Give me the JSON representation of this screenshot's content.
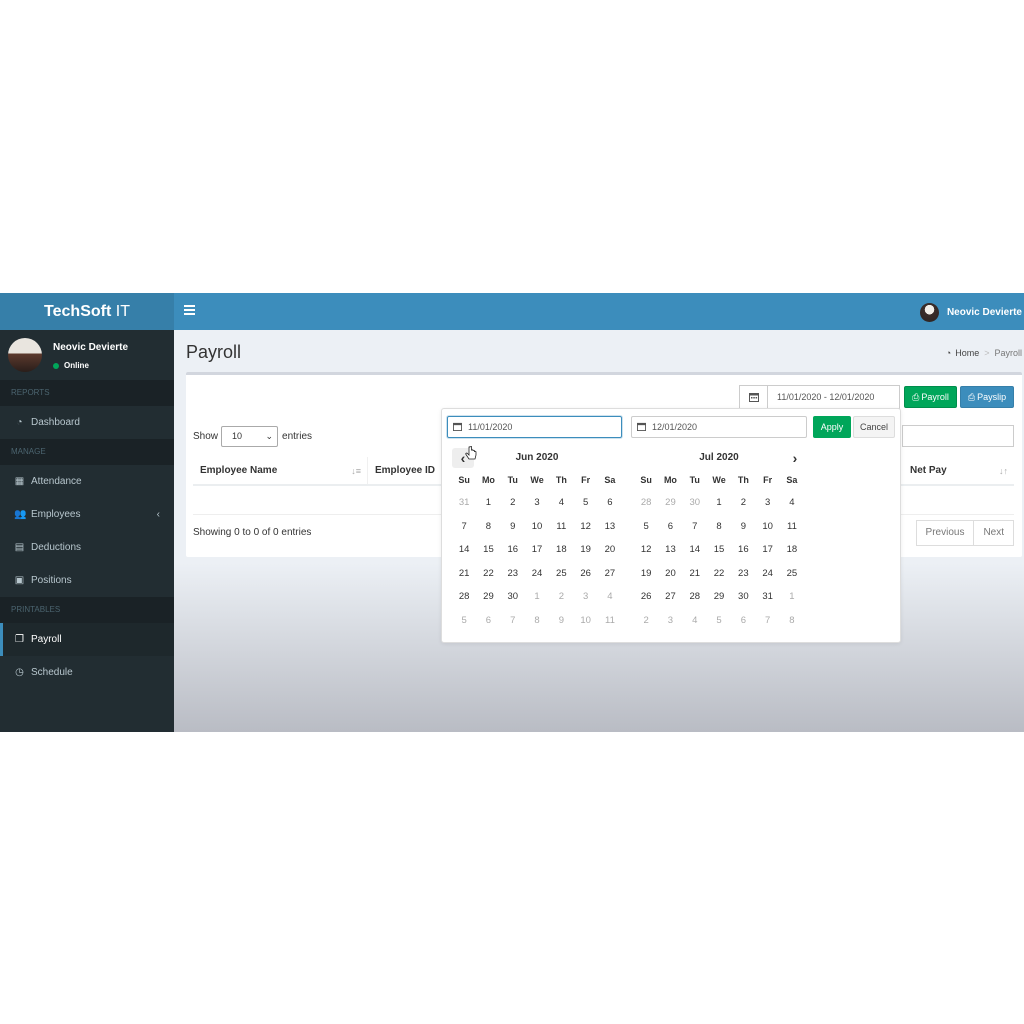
{
  "brand": {
    "bold": "TechSoft",
    "rest": " IT"
  },
  "navbar": {
    "user_name": "Neovic Devierte"
  },
  "sidebar": {
    "user": {
      "name": "Neovic Devierte",
      "status": "Online"
    },
    "sections": [
      {
        "header": "REPORTS",
        "items": [
          {
            "label": "Dashboard",
            "icon": "dashboard-icon",
            "glyph": "◔"
          }
        ]
      },
      {
        "header": "MANAGE",
        "items": [
          {
            "label": "Attendance",
            "icon": "calendar-icon",
            "glyph": "▦"
          },
          {
            "label": "Employees",
            "icon": "users-icon",
            "glyph": "👥",
            "chevron": "‹"
          },
          {
            "label": "Deductions",
            "icon": "file-icon",
            "glyph": "▤"
          },
          {
            "label": "Positions",
            "icon": "briefcase-icon",
            "glyph": "▣"
          }
        ]
      },
      {
        "header": "PRINTABLES",
        "items": [
          {
            "label": "Payroll",
            "icon": "files-icon",
            "glyph": "❐",
            "active": true
          },
          {
            "label": "Schedule",
            "icon": "clock-icon",
            "glyph": "◷"
          }
        ]
      }
    ]
  },
  "page": {
    "title": "Payroll",
    "breadcrumb": {
      "home": "Home",
      "current": "Payroll"
    }
  },
  "toolbar": {
    "date_range": "11/01/2020 - 12/01/2020",
    "payroll_button": "Payroll",
    "payslip_button": "Payslip"
  },
  "table": {
    "show_label": "Show",
    "entries_label": "entries",
    "page_length": "10",
    "columns": [
      "Employee Name",
      "Employee ID",
      "Net Pay"
    ],
    "info": "Showing 0 to 0 of 0 entries",
    "previous": "Previous",
    "next": "Next"
  },
  "datepicker": {
    "start": "11/01/2020",
    "end": "12/01/2020",
    "apply": "Apply",
    "cancel": "Cancel",
    "weekdays": [
      "Su",
      "Mo",
      "Tu",
      "We",
      "Th",
      "Fr",
      "Sa"
    ],
    "months": [
      {
        "label": "Jun 2020",
        "days": [
          [
            "31",
            1
          ],
          [
            "1",
            0
          ],
          [
            "2",
            0
          ],
          [
            "3",
            0
          ],
          [
            "4",
            0
          ],
          [
            "5",
            0
          ],
          [
            "6",
            0
          ],
          [
            "7",
            0
          ],
          [
            "8",
            0
          ],
          [
            "9",
            0
          ],
          [
            "10",
            0
          ],
          [
            "11",
            0
          ],
          [
            "12",
            0
          ],
          [
            "13",
            0
          ],
          [
            "14",
            0
          ],
          [
            "15",
            0
          ],
          [
            "16",
            0
          ],
          [
            "17",
            0
          ],
          [
            "18",
            0
          ],
          [
            "19",
            0
          ],
          [
            "20",
            0
          ],
          [
            "21",
            0
          ],
          [
            "22",
            0
          ],
          [
            "23",
            0
          ],
          [
            "24",
            0
          ],
          [
            "25",
            0
          ],
          [
            "26",
            0
          ],
          [
            "27",
            0
          ],
          [
            "28",
            0
          ],
          [
            "29",
            0
          ],
          [
            "30",
            0
          ],
          [
            "1",
            1
          ],
          [
            "2",
            1
          ],
          [
            "3",
            1
          ],
          [
            "4",
            1
          ],
          [
            "5",
            1
          ],
          [
            "6",
            1
          ],
          [
            "7",
            1
          ],
          [
            "8",
            1
          ],
          [
            "9",
            1
          ],
          [
            "10",
            1
          ],
          [
            "11",
            1
          ]
        ]
      },
      {
        "label": "Jul 2020",
        "days": [
          [
            "28",
            1
          ],
          [
            "29",
            1
          ],
          [
            "30",
            1
          ],
          [
            "1",
            0
          ],
          [
            "2",
            0
          ],
          [
            "3",
            0
          ],
          [
            "4",
            0
          ],
          [
            "5",
            0
          ],
          [
            "6",
            0
          ],
          [
            "7",
            0
          ],
          [
            "8",
            0
          ],
          [
            "9",
            0
          ],
          [
            "10",
            0
          ],
          [
            "11",
            0
          ],
          [
            "12",
            0
          ],
          [
            "13",
            0
          ],
          [
            "14",
            0
          ],
          [
            "15",
            0
          ],
          [
            "16",
            0
          ],
          [
            "17",
            0
          ],
          [
            "18",
            0
          ],
          [
            "19",
            0
          ],
          [
            "20",
            0
          ],
          [
            "21",
            0
          ],
          [
            "22",
            0
          ],
          [
            "23",
            0
          ],
          [
            "24",
            0
          ],
          [
            "25",
            0
          ],
          [
            "26",
            0
          ],
          [
            "27",
            0
          ],
          [
            "28",
            0
          ],
          [
            "29",
            0
          ],
          [
            "30",
            0
          ],
          [
            "31",
            0
          ],
          [
            "1",
            1
          ],
          [
            "2",
            1
          ],
          [
            "3",
            1
          ],
          [
            "4",
            1
          ],
          [
            "5",
            1
          ],
          [
            "6",
            1
          ],
          [
            "7",
            1
          ],
          [
            "8",
            1
          ]
        ]
      }
    ]
  },
  "colors": {
    "navbar": "#3c8dbc",
    "logo_bg": "#367fa9",
    "sidebar": "#222d32",
    "success": "#00a65a",
    "primary": "#3c8dbc"
  }
}
